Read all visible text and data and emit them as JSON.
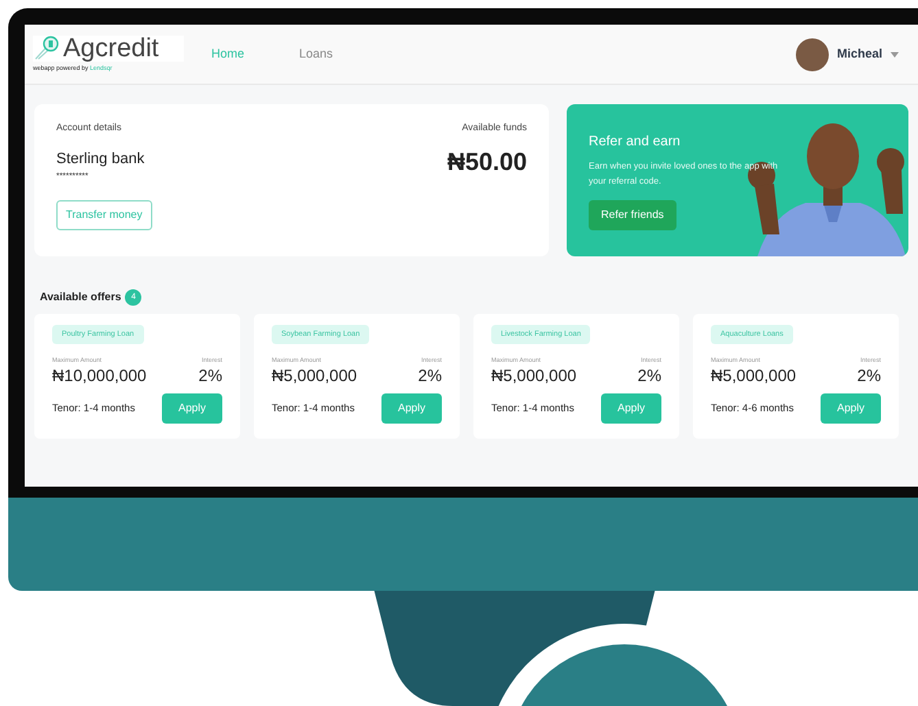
{
  "header": {
    "logo_text": "Agcredit",
    "powered_by": "webapp powered by",
    "powered_brand": "Lendsqr",
    "nav": [
      {
        "label": "Home",
        "selected": true
      },
      {
        "label": "Loans",
        "selected": false
      }
    ],
    "user": {
      "name": "Micheal"
    }
  },
  "account": {
    "label": "Account details",
    "bank": "Sterling bank",
    "masked": "**********",
    "button": "Transfer money",
    "funds_label": "Available funds",
    "funds": "₦50.00"
  },
  "refer": {
    "title": "Refer and earn",
    "text": "Earn when you invite loved ones to the app with your referral code.",
    "button": "Refer friends"
  },
  "offers": {
    "title": "Available offers",
    "count": "4",
    "items": [
      {
        "tag": "Poultry Farming Loan",
        "amount_label": "Maximum Amount",
        "amount": "₦10,000,000",
        "interest_label": "Interest",
        "interest": "2%",
        "tenor": "Tenor: 1-4 months",
        "button": "Apply"
      },
      {
        "tag": "Soybean Farming Loan",
        "amount_label": "Maximum Amount",
        "amount": "₦5,000,000",
        "interest_label": "Interest",
        "interest": "2%",
        "tenor": "Tenor: 1-4 months",
        "button": "Apply"
      },
      {
        "tag": "Livestock Farming Loan",
        "amount_label": "Maximum Amount",
        "amount": "₦5,000,000",
        "interest_label": "Interest",
        "interest": "2%",
        "tenor": "Tenor: 1-4 months",
        "button": "Apply"
      },
      {
        "tag": "Aquaculture Loans",
        "amount_label": "Maximum Amount",
        "amount": "₦5,000,000",
        "interest_label": "Interest",
        "interest": "2%",
        "tenor": "Tenor: 4-6 months",
        "button": "Apply"
      }
    ]
  }
}
